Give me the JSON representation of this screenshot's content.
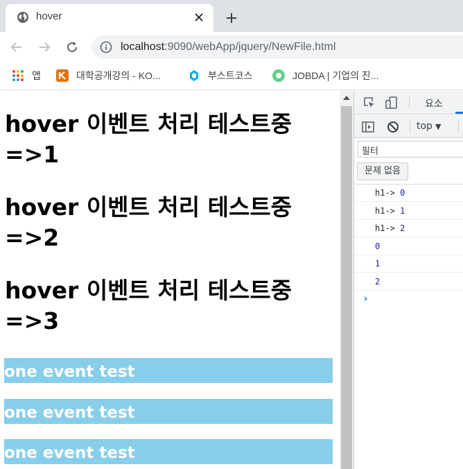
{
  "browser": {
    "tab_title": "hover",
    "url_host": "localhost",
    "url_rest": ":9090/webApp/jquery/NewFile.html"
  },
  "bookmarks": [
    {
      "label": "앱"
    },
    {
      "label": "대학공개강의 - KO..."
    },
    {
      "label": "부스트코스"
    },
    {
      "label": "JOBDA | 기업의 진..."
    }
  ],
  "page": {
    "headings": [
      {
        "line1": "hover 이벤트 처리 테스트중",
        "line2": "=>1"
      },
      {
        "line1": "hover 이벤트 처리 테스트중",
        "line2": "=>2"
      },
      {
        "line1": "hover 이벤트 처리 테스트중",
        "line2": "=>3"
      }
    ],
    "blocks": [
      "one event test",
      "one event test",
      "one event test"
    ],
    "block_color": "#87ceeb"
  },
  "devtools": {
    "tab_elements": "요소",
    "context": "top",
    "filter_placeholder": "필터",
    "issues_label": "문제 없음",
    "console": [
      {
        "key": "h1->",
        "value": "0"
      },
      {
        "key": "h1->",
        "value": "1"
      },
      {
        "key": "h1->",
        "value": "2"
      },
      {
        "key": "",
        "value": "0"
      },
      {
        "key": "",
        "value": "1"
      },
      {
        "key": "",
        "value": "2"
      }
    ],
    "prompt": "›"
  }
}
